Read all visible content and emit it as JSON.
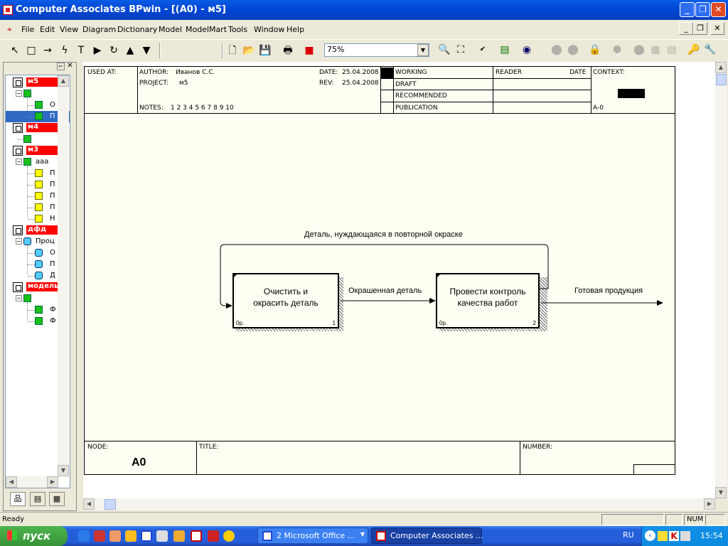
{
  "window": {
    "title": "Computer Associates BPwin - [(A0)  - м5]"
  },
  "menu": {
    "items": [
      "File",
      "Edit",
      "View",
      "Diagram",
      "Dictionary",
      "Model",
      "ModelMart",
      "Tools",
      "Window",
      "Help"
    ]
  },
  "toolbar": {
    "zoom": "75%"
  },
  "explorer": {
    "models": [
      {
        "name": "м5",
        "children": [
          "",
          "О",
          "П"
        ]
      },
      {
        "name": "м4",
        "children": [
          ""
        ]
      },
      {
        "name": "м3",
        "children": [
          "ааа",
          "П",
          "П",
          "П",
          "П",
          "Н"
        ]
      },
      {
        "name": "дфд",
        "children": [
          "Проц",
          "О",
          "П",
          "Д"
        ]
      },
      {
        "name": "модель",
        "children": [
          "",
          "Ф",
          "Ф"
        ]
      }
    ]
  },
  "diagram": {
    "header": {
      "used_at": "USED AT:",
      "author_label": "AUTHOR:",
      "author": "Иванов С.С.",
      "project_label": "PROJECT:",
      "project": "м5",
      "date_label": "DATE:",
      "date": "25.04.2008",
      "rev_label": "REV:",
      "rev": "25.04.2008",
      "notes_label": "NOTES:",
      "notes": "1  2  3  4  5  6  7  8  9  10",
      "status": [
        "WORKING",
        "DRAFT",
        "RECOMMENDED",
        "PUBLICATION"
      ],
      "reader": "READER",
      "date_col": "DATE",
      "context": "CONTEXT:",
      "context_node": "A-0"
    },
    "boxes": [
      {
        "text1": "Очистить и",
        "text2": "окрасить деталь",
        "cost": "0р.",
        "number": "1"
      },
      {
        "text1": "Провести контроль",
        "text2": "качества работ",
        "cost": "0р.",
        "number": "2"
      }
    ],
    "arrows": {
      "feedback": "Деталь, нуждающаяся в повторной окраске",
      "middle": "Окрашенная деталь",
      "output": "Готовая продукция"
    },
    "footer": {
      "node_label": "NODE:",
      "node": "A0",
      "title_label": "TITLE:",
      "number_label": "NUMBER:"
    }
  },
  "status": {
    "text": "Ready",
    "num": "NUM"
  },
  "taskbar": {
    "start": "пуск",
    "tasks": [
      "2 Microsoft Office ...",
      "Computer Associates ..."
    ],
    "lang": "RU",
    "clock": "15:54"
  }
}
